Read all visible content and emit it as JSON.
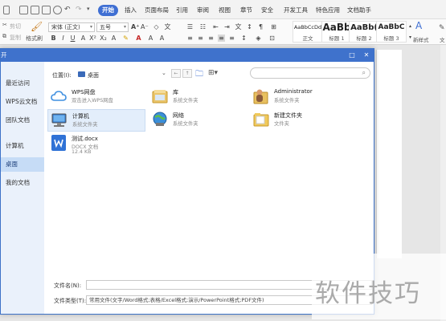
{
  "menubar": {
    "tabs": [
      "开始",
      "插入",
      "页面布局",
      "引用",
      "审阅",
      "视图",
      "章节",
      "安全",
      "开发工具",
      "特色应用",
      "文档助手"
    ],
    "active_tab": "开始"
  },
  "ribbon": {
    "cut_label": "剪切",
    "copy_label": "复制",
    "format_painter_label": "格式刷",
    "font_name": "宋体 (正文)",
    "font_size": "五号",
    "styles": [
      {
        "preview": "AaBbCcDd",
        "label": "正文"
      },
      {
        "preview": "AaBb",
        "label": "标题 1"
      },
      {
        "preview": "AaBb(",
        "label": "标题 2"
      },
      {
        "preview": "AaBbC",
        "label": "标题 3"
      }
    ],
    "new_style_label": "新样式",
    "text_tool_label": "文"
  },
  "dialog": {
    "title": "开",
    "sidebar": [
      {
        "label": "最近访问",
        "selected": false
      },
      {
        "label": "WPS云文档",
        "selected": false
      },
      {
        "label": "团队文档",
        "selected": false
      },
      {
        "label": "计算机",
        "selected": false
      },
      {
        "label": "桌面",
        "selected": true
      },
      {
        "label": "我的文档",
        "selected": false
      }
    ],
    "location_label": "位置(I):",
    "location_value": "桌面",
    "items": [
      {
        "name": "WPS网盘",
        "sub": "双击进入WPS网盘",
        "sub2": "",
        "icon": "cloud-icon"
      },
      {
        "name": "库",
        "sub": "系统文件夹",
        "sub2": "",
        "icon": "library-folder-icon"
      },
      {
        "name": "Administrator",
        "sub": "系统文件夹",
        "sub2": "",
        "icon": "user-folder-icon"
      },
      {
        "name": "计算机",
        "sub": "系统文件夹",
        "sub2": "",
        "icon": "computer-icon"
      },
      {
        "name": "网络",
        "sub": "系统文件夹",
        "sub2": "",
        "icon": "network-icon"
      },
      {
        "name": "新建文件夹",
        "sub": "文件夹",
        "sub2": "",
        "icon": "folder-icon"
      },
      {
        "name": "测试.docx",
        "sub": "DOCX 文档",
        "sub2": "12.4 KB",
        "icon": "docx-file-icon"
      }
    ],
    "filename_label": "文件名(N):",
    "filename_value": "",
    "filetype_label": "文件类型(T):",
    "filetype_value": "常用文件(文字/Word格式;表格/Excel格式;演示/PowerPoint格式;PDF文件)"
  },
  "watermark": "软件技巧"
}
